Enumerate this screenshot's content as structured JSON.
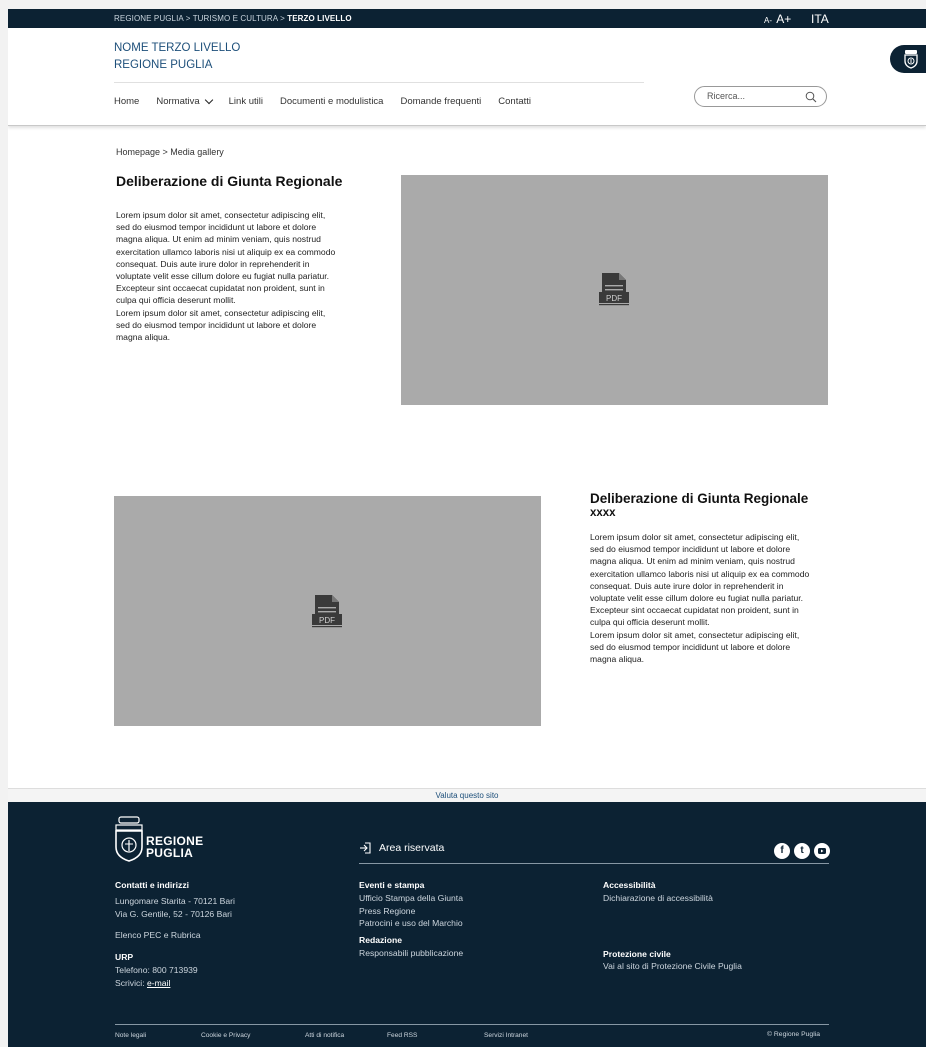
{
  "topbar": {
    "breadcrumb_prefix": "REGIONE PUGLIA > TURISMO E CULTURA > ",
    "breadcrumb_current": "TERZO LIVELLO",
    "font_small": "A-",
    "font_large": "A+",
    "language": "ITA"
  },
  "header": {
    "site_name_line1": "NOME TERZO LIVELLO",
    "site_name_line2": "REGIONE PUGLIA",
    "nav": [
      "Home",
      "Normativa",
      "Link utili",
      "Documenti e modulistica",
      "Domande frequenti",
      "Contatti"
    ],
    "search_placeholder": "Ricerca..."
  },
  "content": {
    "breadcrumb": "Homepage  >  Media gallery",
    "section1_title": "Deliberazione di Giunta Regionale",
    "section2_title_line1": "Deliberazione di Giunta Regionale",
    "section2_title_line2": "xxxx",
    "lorem_lines": [
      "Lorem ipsum dolor sit amet, consectetur adipiscing elit,",
      "sed do eiusmod tempor incididunt ut labore et dolore",
      "magna aliqua. Ut enim ad minim veniam, quis nostrud",
      "exercitation ullamco laboris nisi ut aliquip ex ea commodo",
      "consequat. Duis aute irure dolor in reprehenderit in",
      "voluptate velit esse cillum dolore eu fugiat nulla pariatur.",
      "Excepteur sint occaecat cupidatat non proident, sunt in",
      "culpa qui officia deserunt mollit.",
      "Lorem ipsum dolor sit amet, consectetur adipiscing elit,",
      "sed do eiusmod tempor incididunt ut labore et dolore",
      "magna aliqua."
    ],
    "pdf_label": "PDF"
  },
  "footer": {
    "rate_site": "Valuta questo sito",
    "logo_line1": "REGIONE",
    "logo_line2": "PUGLIA",
    "area_riservata": "Area riservata",
    "col1": {
      "heading": "Contatti e indirizzi",
      "address1": "Lungomare Starita - 70121 Bari",
      "address2": "Via G. Gentile, 52 - 70126 Bari",
      "pec": "Elenco PEC e Rubrica",
      "urp_heading": "URP",
      "phone": "Telefono: 800 713939",
      "write_prefix": "Scrivici: ",
      "email": "e-mail"
    },
    "col2": {
      "heading": "Eventi e stampa",
      "item1": "Ufficio Stampa della Giunta",
      "item2": "Press Regione",
      "item3": "Patrocini e uso del Marchio",
      "heading2": "Redazione",
      "item4": "Responsabili pubblicazione"
    },
    "col3": {
      "heading": "Accessibilità",
      "item1": "Dichiarazione di accessibilità",
      "heading2": "Protezione civile",
      "item2": "Vai al sito di Protezione Civile Puglia"
    },
    "bottom_links": [
      "Note legali",
      "Cookie e Privacy",
      "Atti di notifica",
      "Feed RSS",
      "Servizi Intranet"
    ],
    "copyright": "© Regione Puglia"
  },
  "colors": {
    "navy": "#0c2233",
    "link_blue": "#1d4f7a",
    "placeholder_gray": "#aaaaaa"
  }
}
